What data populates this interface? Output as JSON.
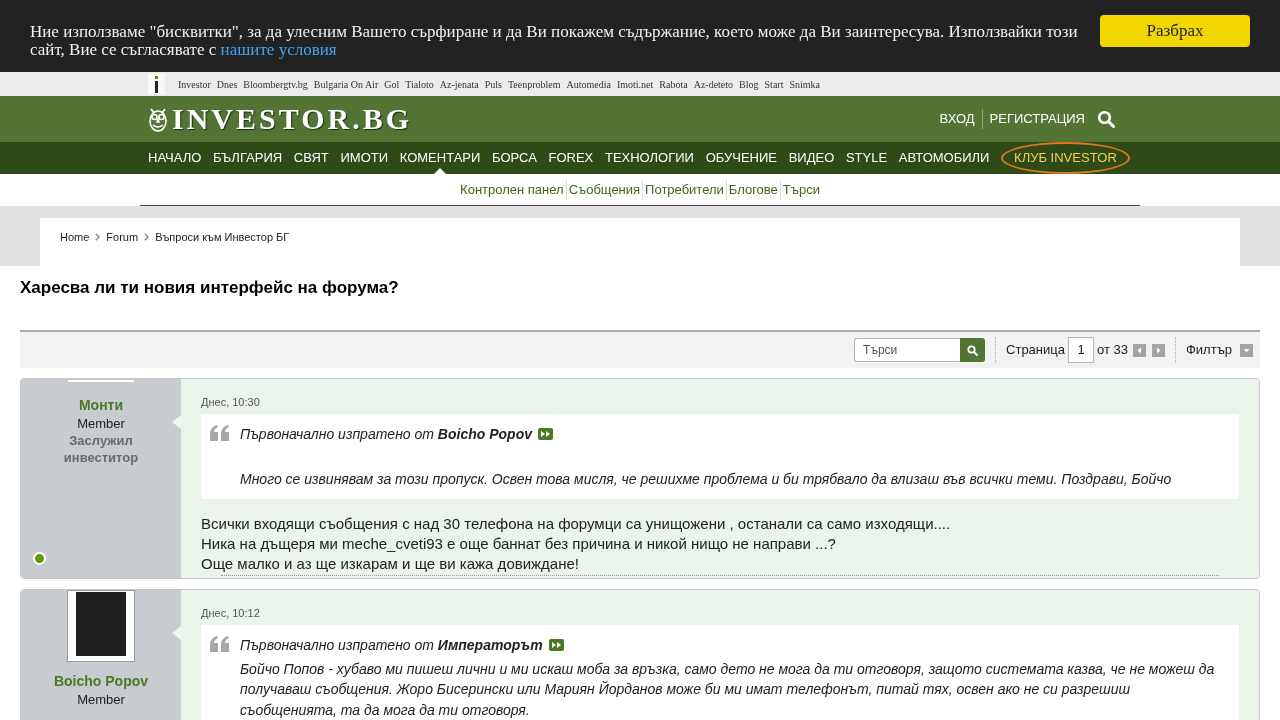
{
  "cookie_banner": {
    "text": "Ние използваме \"бисквитки\", за да улесним Вашето сърфиране и да Ви покажем съдържание, което може да Ви заинтересува. Използвайки този сайт, Вие се съгласявате с",
    "link": "нашите условия",
    "button": "Разбрах"
  },
  "partner_links": [
    "Investor",
    "Dnes",
    "Bloombergtv.bg",
    "Bulgaria On Air",
    "Gol",
    "Tialoto",
    "Az-jenata",
    "Puls",
    "Teenproblem",
    "Automedia",
    "Imoti.net",
    "Rabota",
    "Az-deteto",
    "Blog",
    "Start",
    "Snimka"
  ],
  "header": {
    "logo": "INVESTOR.BG",
    "login": "ВХОД",
    "register": "РЕГИСТРАЦИЯ"
  },
  "nav": [
    {
      "label": "НАЧАЛО",
      "kind": "link",
      "selected": false
    },
    {
      "label": "БЪЛГАРИЯ",
      "kind": "link",
      "selected": false
    },
    {
      "label": "СВЯТ",
      "kind": "link",
      "selected": false
    },
    {
      "label": "ИМОТИ",
      "kind": "link",
      "selected": false
    },
    {
      "label": "КОМЕНТАРИ",
      "kind": "link",
      "selected": true
    },
    {
      "label": "БОРСА",
      "kind": "link",
      "selected": false
    },
    {
      "label": "FOREX",
      "kind": "link",
      "selected": false
    },
    {
      "label": "ТЕХНОЛОГИИ",
      "kind": "link",
      "selected": false
    },
    {
      "label": "ОБУЧЕНИЕ",
      "kind": "link",
      "selected": false
    },
    {
      "label": "ВИДЕО",
      "kind": "link",
      "selected": false
    },
    {
      "label": "STYLE",
      "kind": "link",
      "selected": false
    },
    {
      "label": "АВТОМОБИЛИ",
      "kind": "link",
      "selected": false
    },
    {
      "label": "КЛУБ INVESTOR",
      "kind": "club",
      "selected": false
    }
  ],
  "subnav": [
    "Контролен панел",
    "Съобщения",
    "Потребители",
    "Блогове",
    "Търси"
  ],
  "breadcrumb": [
    "Home",
    "Forum",
    "Въпроси към Инвестор БГ"
  ],
  "thread_title": "Харесва ли ти новия интерфейс на форума?",
  "toolbar": {
    "search": {
      "placeholder": "Търси"
    },
    "page_label": "Страница",
    "page": "1",
    "page_count": "от 33",
    "filter": "Филтър"
  },
  "posts": [
    {
      "author": "Монти",
      "role": "Member",
      "rank": "Заслужил инвеститор",
      "photo": false,
      "online": true,
      "date": "Днес, 10:30",
      "quote": {
        "attribution": "Първоначално изпратено от **Boicho Popov**",
        "blank_line": true,
        "text": "Много се извинявам за този пропуск. Освен това мисля, че решихме проблема и би трябвало да влизаш във всички теми. Поздрави, Бойчо"
      },
      "body": [
        "Всички входящи съобщения с над 30 телефона на форумци са унищожени , останали са само изходящи....",
        "Ника на дъщеря ми meche_cveti93 е още баннат без причина и никой нищо не направи ...?",
        "Още малко и аз ще изкарам и ще ви кажа довиждане!"
      ]
    },
    {
      "author": "Boicho Popov",
      "role": "Member",
      "photo": true,
      "date": "Днес, 10:12",
      "quote": {
        "attribution": "Първоначално изпратено от **Императорът**",
        "blank_line": false,
        "text": "Бойчо Попов - хубаво ми пишеш лични и ми искаш моба за връзка, само дето не мога да ти отговоря, защото системата казва, че не можеш да получаваш съобщения. Жоро Бисерински или Мариян Йорданов може би ми имат телефонът, питай тях, освен ако не си разрешиш съобщенията, та да мога да ти отговоря."
      }
    }
  ]
}
